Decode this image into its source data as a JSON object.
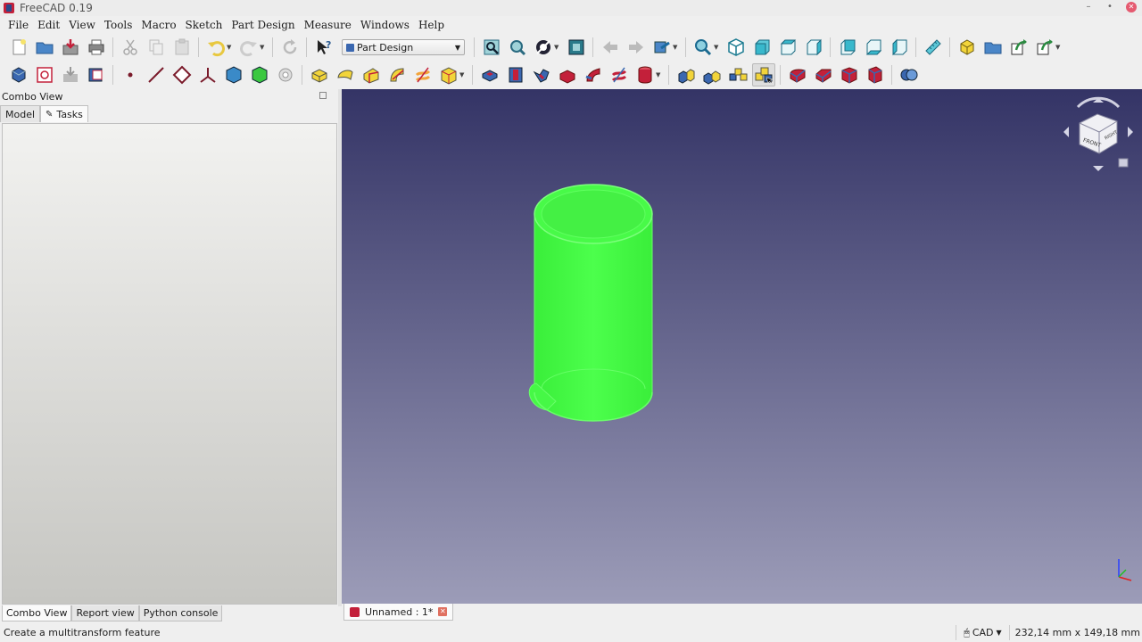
{
  "window": {
    "title": "FreeCAD 0.19",
    "minimize": "–",
    "maximize": "•",
    "close": "✕"
  },
  "menu": [
    "File",
    "Edit",
    "View",
    "Tools",
    "Macro",
    "Sketch",
    "Part Design",
    "Measure",
    "Windows",
    "Help"
  ],
  "workbench": {
    "selected": "Part Design"
  },
  "combo_view": {
    "title": "Combo View",
    "tabs": [
      "Model",
      "Tasks"
    ],
    "active_tab": "Tasks"
  },
  "bottom_tabs": [
    "Combo View",
    "Report view",
    "Python console"
  ],
  "document_tab": {
    "label": "Unnamed : 1*"
  },
  "status": {
    "message": "Create a multitransform feature",
    "nav_style": "CAD",
    "dimensions": "232,14 mm x 149,18 mm"
  },
  "navcube": {
    "face_front": "FRONT",
    "face_right": "RIGHT"
  },
  "colors": {
    "viewport_top": "#343466",
    "viewport_bottom": "#9c9cb8",
    "shape_green": "#44ff44",
    "accent_blue": "#3a67b0",
    "accent_yellow": "#f2d43a",
    "accent_red": "#cc1f2f"
  }
}
